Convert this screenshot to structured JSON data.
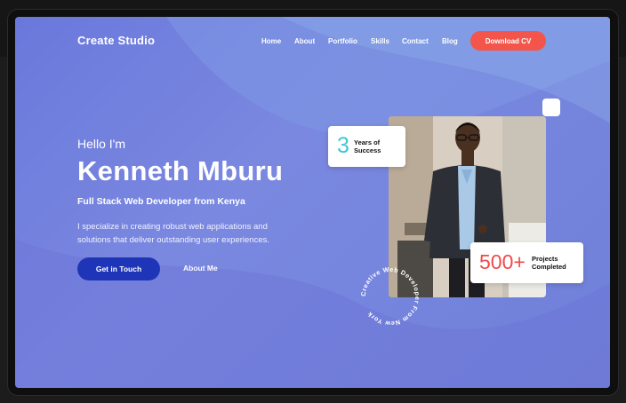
{
  "nav": {
    "brand": "Create Studio",
    "links": [
      "Home",
      "About",
      "Portfolio",
      "Skills",
      "Contact",
      "Blog"
    ],
    "cta": "Download CV"
  },
  "hero": {
    "greeting": "Hello I'm",
    "name": "Kenneth Mburu",
    "role": "Full Stack Web Developer from Kenya",
    "description": "I specialize in creating robust web applications and solutions that deliver outstanding user experiences.",
    "primary_button": "Get in Touch",
    "secondary_button": "About Me"
  },
  "stats": {
    "years_value": "3",
    "years_label": "Years of Success",
    "projects_value": "500+",
    "projects_label": "Projects Completed"
  },
  "badge": {
    "circular_text": "Creative Web Developer From New York"
  },
  "colors": {
    "accent": "#f4554a",
    "primary_button": "#1f35b8",
    "years_number": "#3cc7d6",
    "projects_number": "#f04a4a"
  }
}
